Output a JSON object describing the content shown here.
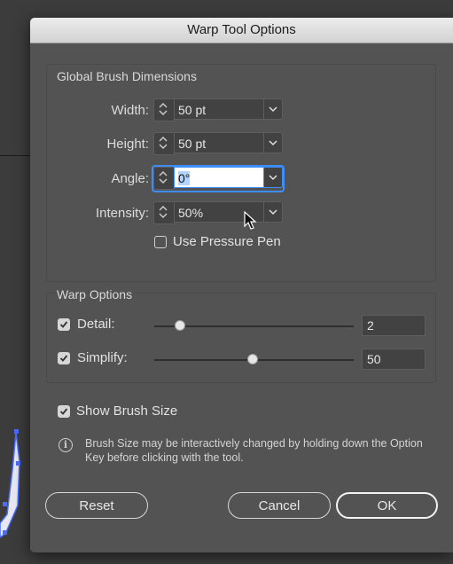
{
  "dialog": {
    "title": "Warp Tool Options"
  },
  "global": {
    "title": "Global Brush Dimensions",
    "width": {
      "label": "Width:",
      "value": "50 pt"
    },
    "height": {
      "label": "Height:",
      "value": "50 pt"
    },
    "angle": {
      "label": "Angle:",
      "value": "0°"
    },
    "intensity": {
      "label": "Intensity:",
      "value": "50%"
    },
    "pressure_pen": {
      "label": "Use Pressure Pen",
      "checked": false
    }
  },
  "warp": {
    "title": "Warp Options",
    "detail": {
      "label": "Detail:",
      "checked": true,
      "value": "2"
    },
    "simplify": {
      "label": "Simplify:",
      "checked": true,
      "value": "50"
    }
  },
  "show_brush_size": {
    "label": "Show Brush Size",
    "checked": true
  },
  "info": {
    "icon": "info-icon",
    "text": "Brush Size may be interactively changed by holding down the Option Key before clicking with the tool."
  },
  "buttons": {
    "reset": "Reset",
    "cancel": "Cancel",
    "ok": "OK"
  },
  "colors": {
    "focus": "#3d8dfd",
    "dialog_bg": "#535353"
  }
}
